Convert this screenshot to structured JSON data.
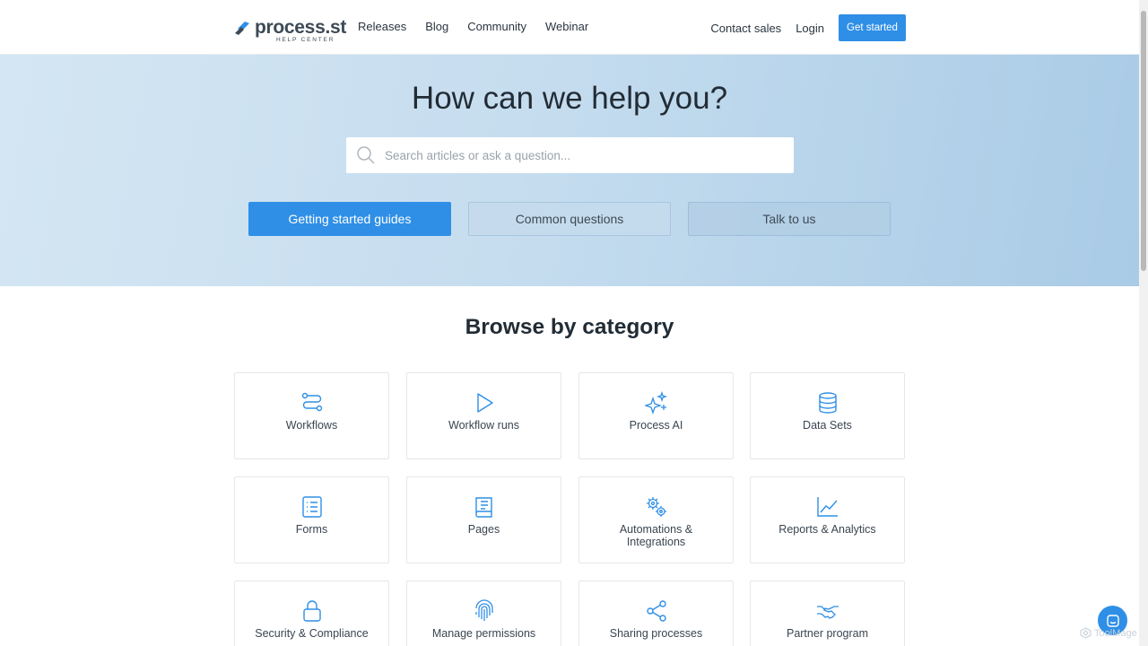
{
  "header": {
    "logo_word": "process.st",
    "logo_sub": "HELP CENTER",
    "nav": [
      "Releases",
      "Blog",
      "Community",
      "Webinar"
    ],
    "contact": "Contact sales",
    "login": "Login",
    "cta": "Get started"
  },
  "hero": {
    "title": "How can we help you?",
    "search_placeholder": "Search articles or ask a question...",
    "buttons": [
      "Getting started guides",
      "Common questions",
      "Talk to us"
    ]
  },
  "browse": {
    "title": "Browse by category",
    "categories": [
      {
        "label": "Workflows",
        "icon": "workflow-icon"
      },
      {
        "label": "Workflow runs",
        "icon": "play-icon"
      },
      {
        "label": "Process AI",
        "icon": "sparkles-icon"
      },
      {
        "label": "Data Sets",
        "icon": "database-icon"
      },
      {
        "label": "Forms",
        "icon": "form-list-icon"
      },
      {
        "label": "Pages",
        "icon": "book-icon"
      },
      {
        "label": "Automations & Integrations",
        "icon": "gears-icon"
      },
      {
        "label": "Reports & Analytics",
        "icon": "line-chart-icon"
      },
      {
        "label": "Security & Compliance",
        "icon": "lock-icon"
      },
      {
        "label": "Manage permissions",
        "icon": "fingerprint-icon"
      },
      {
        "label": "Sharing processes",
        "icon": "share-icon"
      },
      {
        "label": "Partner program",
        "icon": "handshake-icon"
      }
    ]
  },
  "watermark": "ToolMage",
  "colors": {
    "accent": "#2f8fe6",
    "hero_start": "#d4e6f3",
    "hero_end": "#a9cbe6",
    "text": "#222c35"
  }
}
